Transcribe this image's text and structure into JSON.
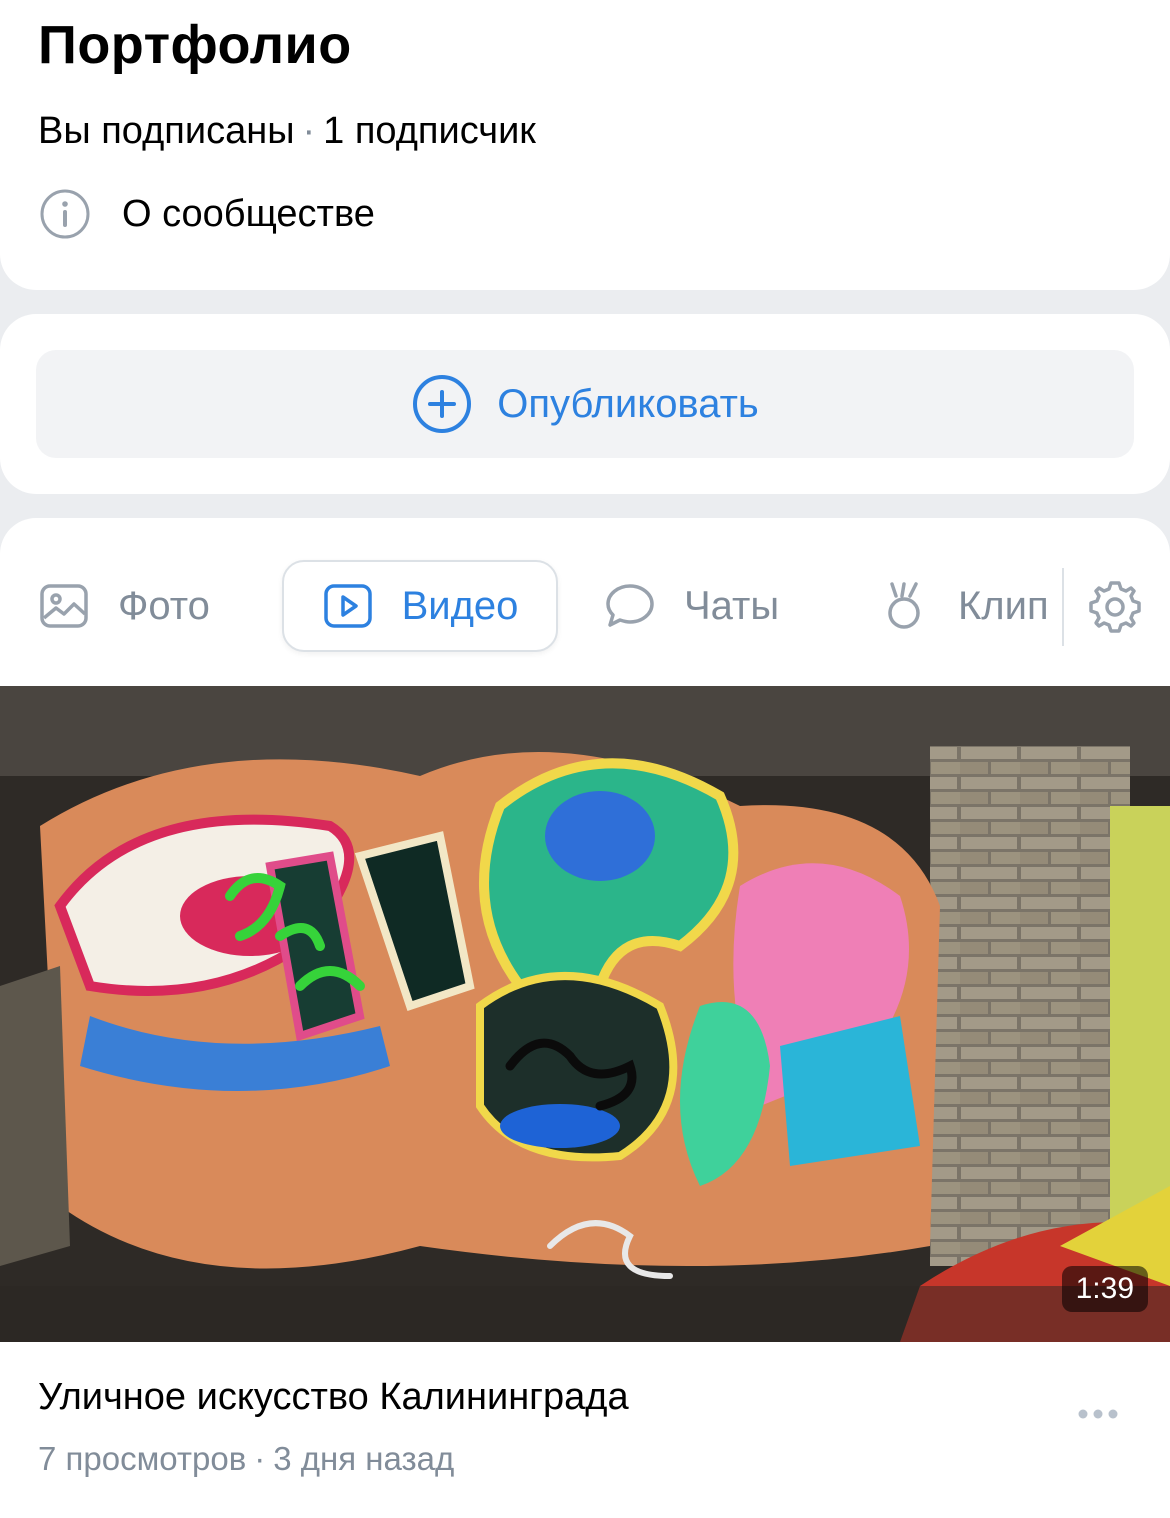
{
  "header": {
    "title": "Портфолио",
    "subscription_status": "Вы подписаны",
    "subscribers_count": "1",
    "subscribers_label": "подписчик",
    "separator": "·",
    "about_label": "О сообществе"
  },
  "publish": {
    "label": "Опубликовать",
    "icon": "plus-circle-icon"
  },
  "tabs": [
    {
      "label": "Фото",
      "icon": "image-icon",
      "active": false
    },
    {
      "label": "Видео",
      "icon": "video-play-icon",
      "active": true
    },
    {
      "label": "Чаты",
      "icon": "chat-bubble-icon",
      "active": false
    },
    {
      "label": "Клип",
      "icon": "clips-icon",
      "active": false
    }
  ],
  "video": {
    "duration": "1:39",
    "title": "Уличное искусство Калининграда",
    "views": "7 просмотров",
    "separator": "·",
    "posted": "3 дня назад"
  },
  "colors": {
    "accent": "#2d81e0",
    "secondary_text": "#818c99",
    "background": "#ebedf0",
    "button_bg": "#f2f3f5"
  }
}
